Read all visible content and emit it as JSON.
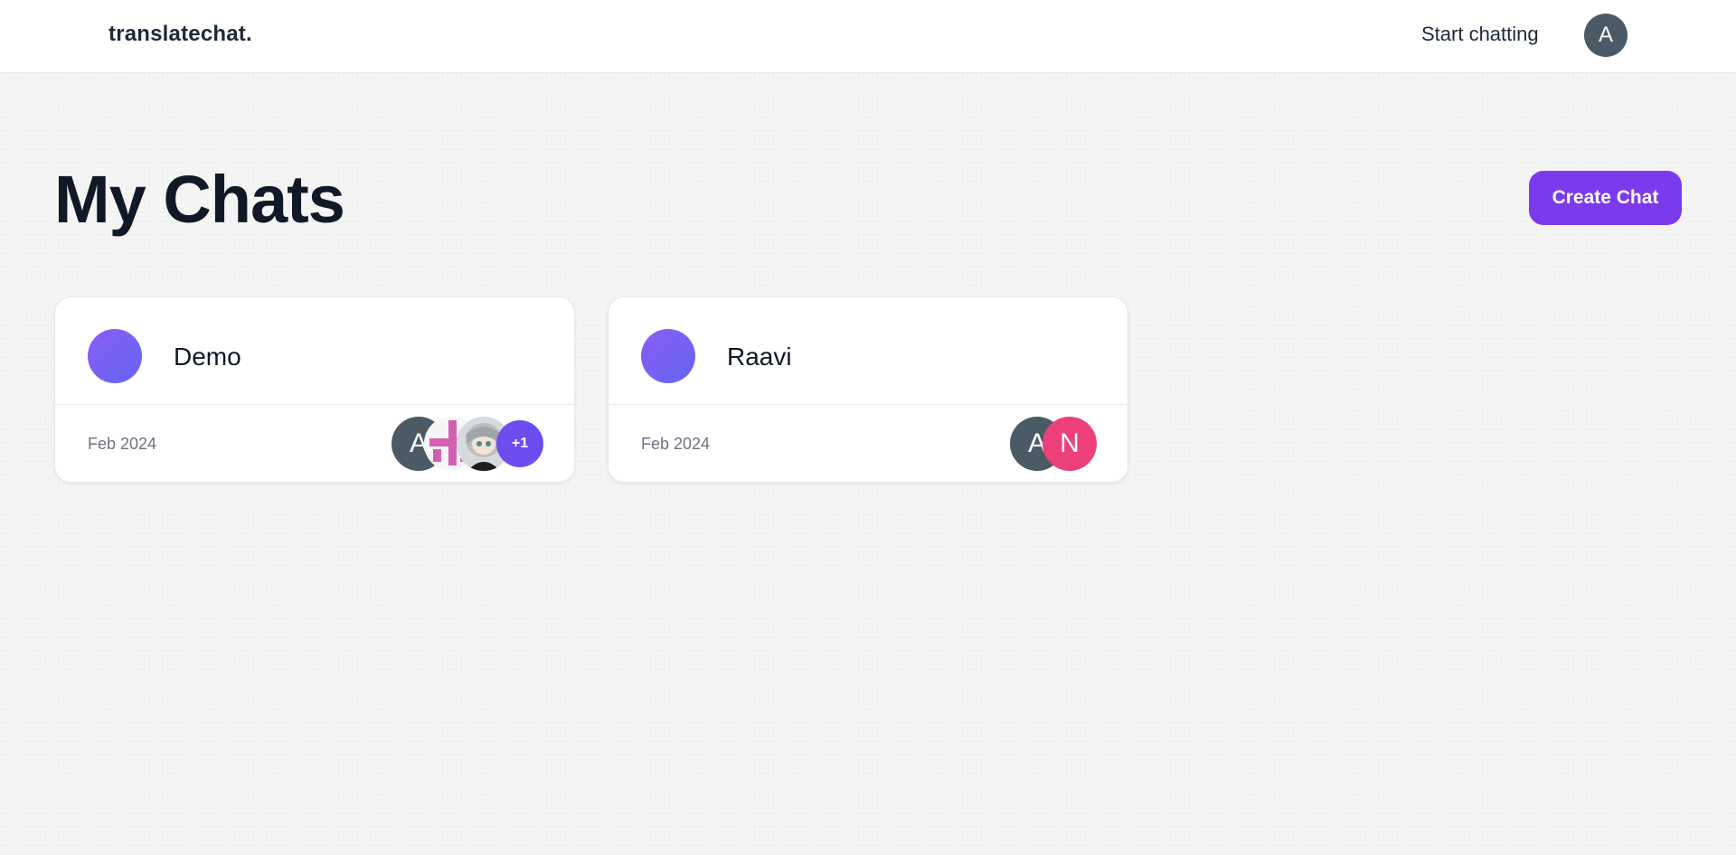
{
  "nav": {
    "brand": "translatechat.",
    "start_link": "Start chatting",
    "user_avatar": "A"
  },
  "page": {
    "title": "My Chats",
    "create_button": "Create Chat"
  },
  "chats": [
    {
      "name": "Demo",
      "date": "Feb 2024",
      "participants": [
        "A",
        "pattern-avatar-icon",
        "anime-avatar-icon"
      ],
      "more_count": "+1"
    },
    {
      "name": "Raavi",
      "date": "Feb 2024",
      "participants": [
        "A",
        "N"
      ]
    }
  ],
  "colors": {
    "accent": "#7c3aed",
    "avatar_slate": "#4b5b66",
    "avatar_pink": "#ec407a"
  }
}
